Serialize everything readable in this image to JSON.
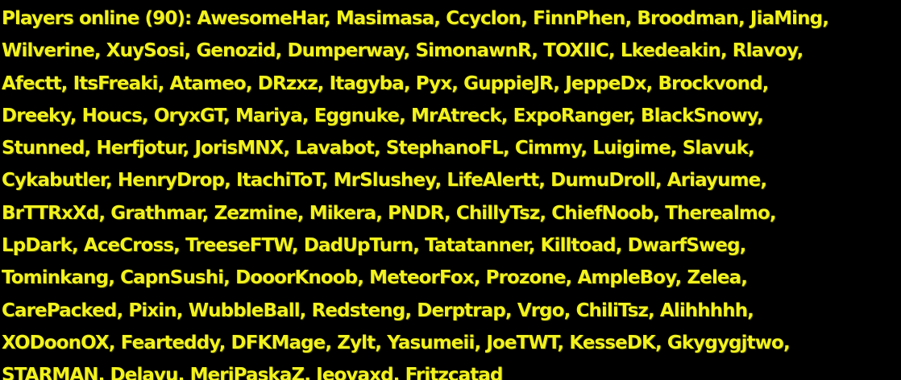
{
  "chat": {
    "text_color": "#f2f21e",
    "background_color": "#000000",
    "lines": [
      "Players online (90): AwesomeHar, Masimasa, Ccyclon, FinnPhen, Broodman, JiaMing,",
      "Wilverine, XuySosi, Genozid, Dumperway, SimonawnR, TOXIIC, Lkedeakin, Rlavoy,",
      "Afectt, ItsFreaki, Atameo, DRzxz, Itagyba, Pyx, GuppieJR, JeppeDx, Brockvond,",
      "Dreeky, Houcs, OryxGT, Mariya, Eggnuke, MrAtreck, ExpoRanger, BlackSnowy,",
      "Stunned, Herfjotur, JorisMNX, Lavabot, StephanoFL, Cimmy, Luigime, Slavuk,",
      "Cykabutler, HenryDrop, ItachiToT, MrSlushey, LifeAlertt, DumuDroll, Ariayume,",
      "BrTTRxXd, Grathmar, Zezmine, Mikera, PNDR, ChillyTsz, ChiefNoob, Therealmo,",
      "LpDark, AceCross, TreeseFTW, DadUpTurn, Tatatanner, Killtoad, DwarfSweg,",
      "Tominkang, CapnSushi, DooorKnoob, MeteorFox, Prozone, AmpleBoy, Zelea,",
      "CarePacked, Pixin, WubbleBall, Redsteng, Derptrap, Vrgo, ChiliTsz, Alihhhhh,",
      "XODoonOX, Fearteddy, DFKMage, Zylt, Yasumeii, JoeTWT, KesseDK, Gkygygjtwo,",
      "STARMAN, Delavu, MeriPaskaZ, Jeovaxd, Fritzcatad"
    ]
  }
}
